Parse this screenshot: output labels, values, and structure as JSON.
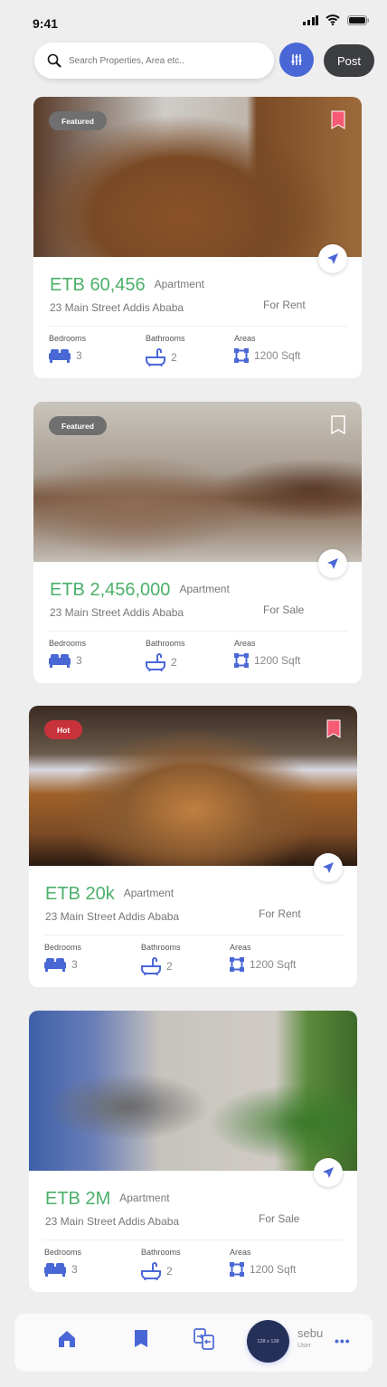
{
  "status": {
    "time": "9:41"
  },
  "search": {
    "placeholder": "Search Properties, Area etc.."
  },
  "header": {
    "post_label": "Post"
  },
  "colors": {
    "accent": "#4a67d6",
    "price": "#4caf6a",
    "bookmark": "#f75a73",
    "hot": "#c8323a"
  },
  "listings": [
    {
      "badge": "Featured",
      "badge_color": "#6f6f6f",
      "bookmarked": true,
      "price": "ETB 60,456",
      "type": "Apartment",
      "address": "23 Main Street Addis Ababa",
      "deal": "For Rent",
      "bedrooms_label": "Bedrooms",
      "bedrooms": "3",
      "bathrooms_label": "Bathrooms",
      "bathrooms": "2",
      "areas_label": "Areas",
      "area": "1200 Sqft"
    },
    {
      "badge": "Featured",
      "badge_color": "#6f6f6f",
      "bookmarked": false,
      "price": "ETB 2,456,000",
      "type": "Apartment",
      "address": "23 Main Street Addis Ababa",
      "deal": "For Sale",
      "bedrooms_label": "Bedrooms",
      "bedrooms": "3",
      "bathrooms_label": "Bathrooms",
      "bathrooms": "2",
      "areas_label": "Areas",
      "area": "1200 Sqft"
    },
    {
      "badge": "Hot",
      "badge_color": "#c8323a",
      "bookmarked": true,
      "price": "ETB 20k",
      "type": "Apartment",
      "address": "23 Main Street Addis Ababa",
      "deal": "For Rent",
      "bedrooms_label": "Bedrooms",
      "bedrooms": "3",
      "bathrooms_label": "Bathrooms",
      "bathrooms": "2",
      "areas_label": "Areas",
      "area": "1200 Sqft"
    },
    {
      "badge": null,
      "bookmarked": null,
      "price": "ETB 2M",
      "type": "Apartment",
      "address": "23 Main Street Addis Ababa",
      "deal": "For Sale",
      "bedrooms_label": "Bedrooms",
      "bedrooms": "3",
      "bathrooms_label": "Bathrooms",
      "bathrooms": "2",
      "areas_label": "Areas",
      "area": "1200 Sqft"
    }
  ],
  "bottom_nav": {
    "avatar_placeholder": "128 x 128",
    "user_name": "sebu",
    "user_role": "User",
    "more": "•••"
  }
}
